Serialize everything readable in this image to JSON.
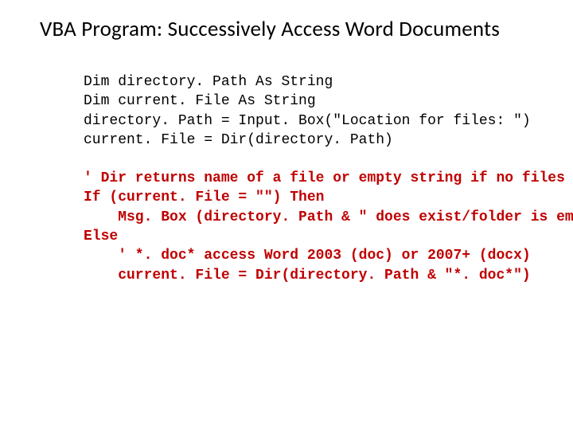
{
  "title": "VBA Program: Successively Access Word Documents",
  "code": {
    "l1": "Dim directory. Path As String",
    "l2": "Dim current. File As String",
    "l3": "directory. Path = Input. Box(\"Location for files: \")",
    "l4": "current. File = Dir(directory. Path)",
    "l5": "' Dir returns name of a file or empty string if no files",
    "l6": "If (current. File = \"\") Then",
    "l7": "    Msg. Box (directory. Path & \" does exist/folder is empty\")",
    "l8": "Else",
    "l9": "    ' *. doc* access Word 2003 (doc) or 2007+ (docx)",
    "l10": "    current. File = Dir(directory. Path & \"*. doc*\")"
  }
}
